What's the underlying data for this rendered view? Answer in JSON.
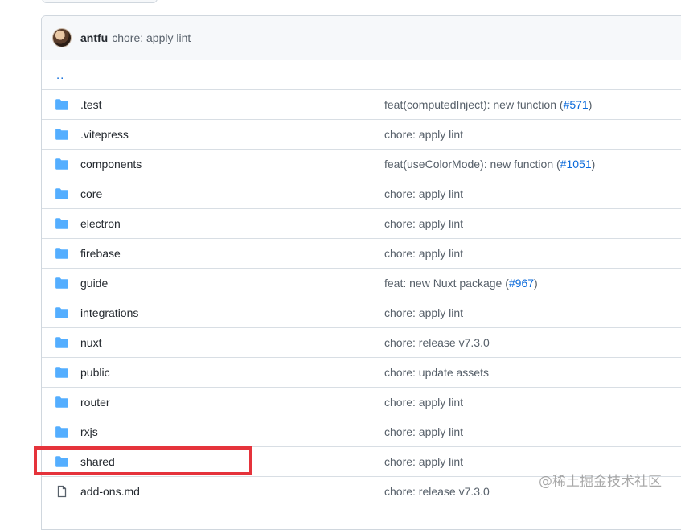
{
  "commit": {
    "author": "antfu",
    "message": "chore: apply lint"
  },
  "parent_link": "..",
  "files": [
    {
      "type": "folder",
      "name": ".test",
      "message": "feat(computedInject): new function (",
      "pr": "#571",
      "message_end": ")"
    },
    {
      "type": "folder",
      "name": ".vitepress",
      "message": "chore: apply lint",
      "pr": "",
      "message_end": ""
    },
    {
      "type": "folder",
      "name": "components",
      "message": "feat(useColorMode): new function (",
      "pr": "#1051",
      "message_end": ")"
    },
    {
      "type": "folder",
      "name": "core",
      "message": "chore: apply lint",
      "pr": "",
      "message_end": ""
    },
    {
      "type": "folder",
      "name": "electron",
      "message": "chore: apply lint",
      "pr": "",
      "message_end": ""
    },
    {
      "type": "folder",
      "name": "firebase",
      "message": "chore: apply lint",
      "pr": "",
      "message_end": ""
    },
    {
      "type": "folder",
      "name": "guide",
      "message": "feat: new Nuxt package (",
      "pr": "#967",
      "message_end": ")"
    },
    {
      "type": "folder",
      "name": "integrations",
      "message": "chore: apply lint",
      "pr": "",
      "message_end": ""
    },
    {
      "type": "folder",
      "name": "nuxt",
      "message": "chore: release v7.3.0",
      "pr": "",
      "message_end": ""
    },
    {
      "type": "folder",
      "name": "public",
      "message": "chore: update assets",
      "pr": "",
      "message_end": ""
    },
    {
      "type": "folder",
      "name": "router",
      "message": "chore: apply lint",
      "pr": "",
      "message_end": ""
    },
    {
      "type": "folder",
      "name": "rxjs",
      "message": "chore: apply lint",
      "pr": "",
      "message_end": ""
    },
    {
      "type": "folder",
      "name": "shared",
      "message": "chore: apply lint",
      "pr": "",
      "message_end": ""
    },
    {
      "type": "file",
      "name": "add-ons.md",
      "message": "chore: release v7.3.0",
      "pr": "",
      "message_end": ""
    }
  ],
  "highlighted_item": "shared",
  "watermark": "@稀土掘金技术社区",
  "colors": {
    "folder_icon": "#54aeff",
    "link": "#0969da",
    "highlight": "#e5333b"
  }
}
